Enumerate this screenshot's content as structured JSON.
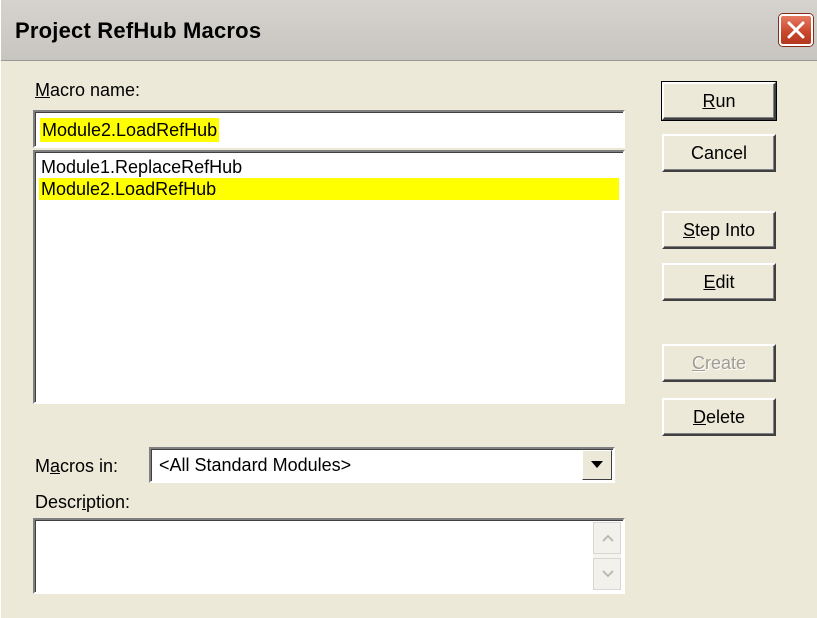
{
  "window": {
    "title": "Project RefHub Macros"
  },
  "macro_name": {
    "label_pre": "",
    "label_accel": "M",
    "label_post": "acro name:",
    "value": "Module2.LoadRefHub"
  },
  "macro_list": {
    "items": [
      {
        "label": "Module1.ReplaceRefHub",
        "selected": false
      },
      {
        "label": "Module2.LoadRefHub",
        "selected": true
      }
    ]
  },
  "macros_in": {
    "label_pre": "M",
    "label_accel": "a",
    "label_post": "cros in:",
    "selected_value": "<All Standard Modules>"
  },
  "description": {
    "label_pre": "Descr",
    "label_accel": "i",
    "label_post": "ption:",
    "value": ""
  },
  "buttons": {
    "run": {
      "pre": "",
      "accel": "R",
      "post": "un",
      "enabled": true
    },
    "cancel": {
      "pre": "Cancel",
      "accel": "",
      "post": "",
      "enabled": true
    },
    "step_into": {
      "pre": "",
      "accel": "S",
      "post": "tep Into",
      "enabled": true
    },
    "edit": {
      "pre": "",
      "accel": "E",
      "post": "dit",
      "enabled": true
    },
    "create": {
      "pre": "",
      "accel": "C",
      "post": "reate",
      "enabled": false
    },
    "delete": {
      "pre": "",
      "accel": "D",
      "post": "elete",
      "enabled": true
    }
  },
  "colors": {
    "selection_highlight": "#ffff00",
    "dialog_background": "#ece9d8",
    "close_button": "#c8452a"
  },
  "icons": {
    "close": "close-icon",
    "dropdown": "chevron-down-icon",
    "scroll_up": "scroll-up-arrow-icon",
    "scroll_down": "scroll-down-arrow-icon"
  }
}
